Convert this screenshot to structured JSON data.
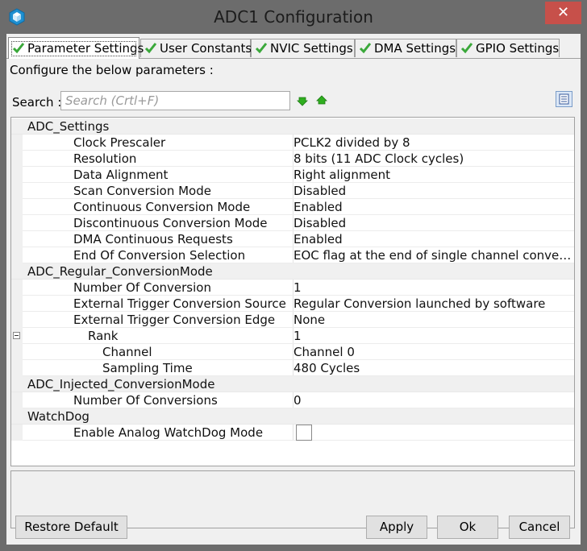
{
  "window": {
    "title": "ADC1 Configuration",
    "close_label": "✕"
  },
  "tabs": [
    {
      "label": "Parameter Settings",
      "active": true
    },
    {
      "label": "User Constants",
      "active": false
    },
    {
      "label": "NVIC Settings",
      "active": false
    },
    {
      "label": "DMA Settings",
      "active": false
    },
    {
      "label": "GPIO Settings",
      "active": false
    }
  ],
  "panel": {
    "subtitle": "Configure the below parameters :",
    "search_label": "Search :",
    "search_placeholder": "Search (Crtl+F)",
    "search_value": ""
  },
  "parameters": [
    {
      "type": "category",
      "name": "ADC_Settings"
    },
    {
      "type": "param",
      "level": 1,
      "name": "Clock Prescaler",
      "value": "PCLK2 divided by 8"
    },
    {
      "type": "param",
      "level": 1,
      "name": "Resolution",
      "value": "8 bits (11 ADC Clock cycles)"
    },
    {
      "type": "param",
      "level": 1,
      "name": "Data Alignment",
      "value": "Right alignment"
    },
    {
      "type": "param",
      "level": 1,
      "name": "Scan Conversion Mode",
      "value": "Disabled"
    },
    {
      "type": "param",
      "level": 1,
      "name": "Continuous Conversion Mode",
      "value": "Enabled"
    },
    {
      "type": "param",
      "level": 1,
      "name": "Discontinuous Conversion Mode",
      "value": "Disabled"
    },
    {
      "type": "param",
      "level": 1,
      "name": "DMA Continuous Requests",
      "value": "Enabled"
    },
    {
      "type": "param",
      "level": 1,
      "name": "End Of Conversion Selection",
      "value": "EOC flag at the end of single channel conversi…"
    },
    {
      "type": "category",
      "name": "ADC_Regular_ConversionMode"
    },
    {
      "type": "param",
      "level": 1,
      "name": "Number Of Conversion",
      "value": "1"
    },
    {
      "type": "param",
      "level": 1,
      "name": "External Trigger Conversion Source",
      "value": "Regular Conversion launched by software"
    },
    {
      "type": "param",
      "level": 1,
      "name": "External Trigger Conversion Edge",
      "value": "None"
    },
    {
      "type": "group",
      "level": 2,
      "name": "Rank",
      "value": "1"
    },
    {
      "type": "param",
      "level": 3,
      "name": "Channel",
      "value": "Channel 0"
    },
    {
      "type": "param",
      "level": 3,
      "name": "Sampling Time",
      "value": "480 Cycles"
    },
    {
      "type": "category",
      "name": "ADC_Injected_ConversionMode"
    },
    {
      "type": "param",
      "level": 1,
      "name": "Number Of Conversions",
      "value": "0"
    },
    {
      "type": "category",
      "name": "WatchDog"
    },
    {
      "type": "checkbox",
      "level": 1,
      "name": "Enable Analog WatchDog Mode",
      "checked": false
    }
  ],
  "buttons": {
    "restore": "Restore Default",
    "apply": "Apply",
    "ok": "Ok",
    "cancel": "Cancel"
  },
  "colors": {
    "check_green": "#3aa83a",
    "arrow_green": "#2fae1f",
    "close_red": "#c7504a"
  }
}
